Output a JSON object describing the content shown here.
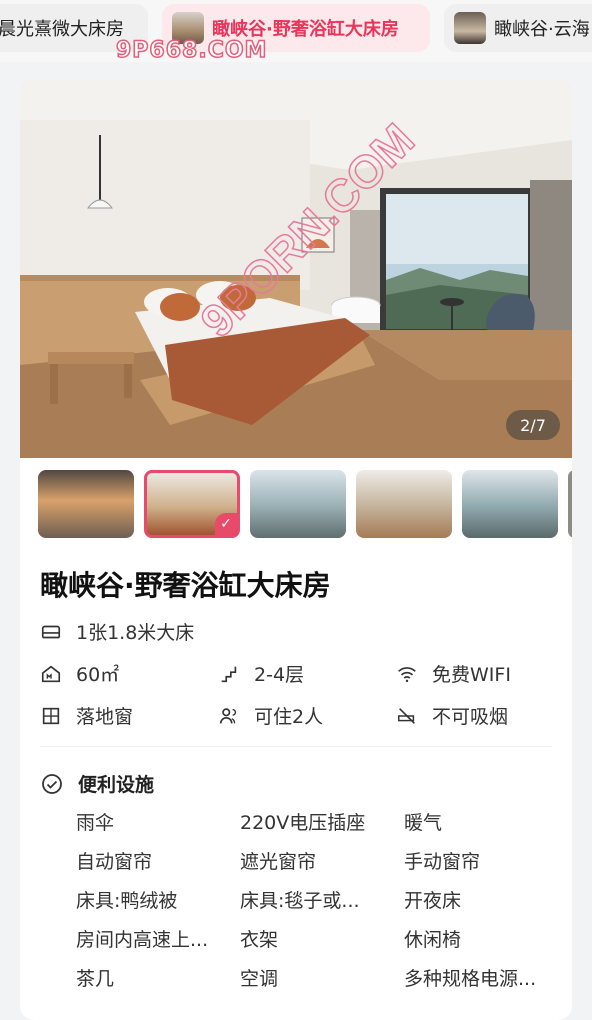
{
  "tabs": [
    {
      "label": "晨光熹微大床房",
      "selected": false
    },
    {
      "label": "瞰峡谷·野奢浴缸大床房",
      "selected": true
    },
    {
      "label": "瞰峡谷·云海",
      "selected": false
    }
  ],
  "watermark": {
    "top": "9P668.COM",
    "diagonal": "9PORN.COM"
  },
  "gallery": {
    "counter": "2/7",
    "selected_index": 1,
    "thumb_count": 5
  },
  "room": {
    "title": "瞰峡谷·野奢浴缸大床房",
    "bed": "1张1.8米大床",
    "area": "60㎡",
    "floor": "2-4层",
    "wifi": "免费WIFI",
    "window": "落地窗",
    "occupancy": "可住2人",
    "smoking": "不可吸烟"
  },
  "facilities": {
    "title": "便利设施",
    "items": [
      "雨伞",
      "220V电压插座",
      "暖气",
      "自动窗帘",
      "遮光窗帘",
      "手动窗帘",
      "床具:鸭绒被",
      "床具:毯子或...",
      "开夜床",
      "房间内高速上...",
      "衣架",
      "休闲椅",
      "茶几",
      "空调",
      "多种规格电源..."
    ]
  },
  "colors": {
    "accent": "#e84a6a",
    "accent_bg": "#fde8ec"
  }
}
